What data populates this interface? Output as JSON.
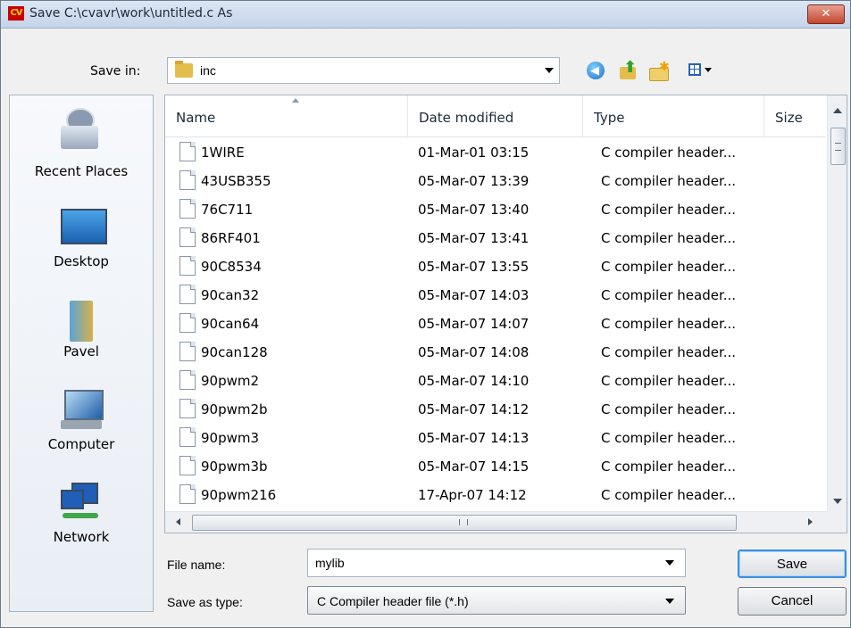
{
  "window": {
    "title": "Save C:\\cvavr\\work\\untitled.c As",
    "app_icon_text": "CV",
    "close_glyph": "✕"
  },
  "toolbar": {
    "save_in_label": "Save in:",
    "save_in_value": "inc",
    "icons": [
      "back-icon",
      "up-folder-icon",
      "new-folder-icon",
      "views-icon"
    ]
  },
  "places": [
    {
      "label": "Recent Places",
      "icon": "recent-places-icon"
    },
    {
      "label": "Desktop",
      "icon": "desktop-icon"
    },
    {
      "label": "Pavel",
      "icon": "user-folder-icon"
    },
    {
      "label": "Computer",
      "icon": "computer-icon"
    },
    {
      "label": "Network",
      "icon": "network-icon"
    }
  ],
  "columns": {
    "name": "Name",
    "date": "Date modified",
    "type": "Type",
    "size": "Size"
  },
  "files": [
    {
      "name": "1WIRE",
      "date": "01-Mar-01 03:15",
      "type": "C compiler header..."
    },
    {
      "name": "43USB355",
      "date": "05-Mar-07 13:39",
      "type": "C compiler header..."
    },
    {
      "name": "76C711",
      "date": "05-Mar-07 13:40",
      "type": "C compiler header..."
    },
    {
      "name": "86RF401",
      "date": "05-Mar-07 13:41",
      "type": "C compiler header..."
    },
    {
      "name": "90C8534",
      "date": "05-Mar-07 13:55",
      "type": "C compiler header..."
    },
    {
      "name": "90can32",
      "date": "05-Mar-07 14:03",
      "type": "C compiler header..."
    },
    {
      "name": "90can64",
      "date": "05-Mar-07 14:07",
      "type": "C compiler header..."
    },
    {
      "name": "90can128",
      "date": "05-Mar-07 14:08",
      "type": "C compiler header..."
    },
    {
      "name": "90pwm2",
      "date": "05-Mar-07 14:10",
      "type": "C compiler header..."
    },
    {
      "name": "90pwm2b",
      "date": "05-Mar-07 14:12",
      "type": "C compiler header..."
    },
    {
      "name": "90pwm3",
      "date": "05-Mar-07 14:13",
      "type": "C compiler header..."
    },
    {
      "name": "90pwm3b",
      "date": "05-Mar-07 14:15",
      "type": "C compiler header..."
    },
    {
      "name": "90pwm216",
      "date": "17-Apr-07 14:12",
      "type": "C compiler header..."
    }
  ],
  "form": {
    "file_name_label": "File name:",
    "file_name_value": "mylib",
    "save_as_type_label": "Save as type:",
    "save_as_type_value": "C Compiler header file (*.h)"
  },
  "buttons": {
    "save": "Save",
    "cancel": "Cancel"
  },
  "scrollbar": {
    "h_grip": "III"
  }
}
